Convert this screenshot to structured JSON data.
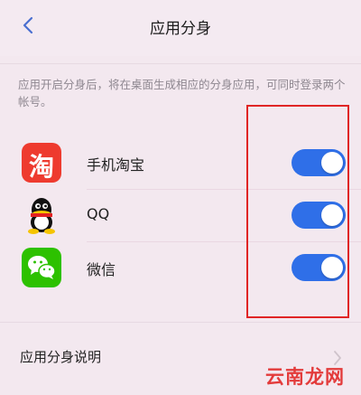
{
  "nav": {
    "title": "应用分身"
  },
  "description": "应用开启分身后，将在桌面生成相应的分身应用，可同时登录两个帐号。",
  "apps": [
    {
      "name": "手机淘宝",
      "icon": "taobao-icon",
      "icon_glyph": "淘",
      "enabled": true
    },
    {
      "name": "QQ",
      "icon": "qq-icon",
      "enabled": true
    },
    {
      "name": "微信",
      "icon": "wechat-icon",
      "enabled": true
    }
  ],
  "help": {
    "label": "应用分身说明"
  },
  "watermark": "云南龙网",
  "colors": {
    "toggle_on": "#2f6fe8",
    "highlight_box": "#e02525",
    "taobao": "#ee3b2f",
    "wechat": "#2dc100",
    "background": "#f3e8ef"
  }
}
